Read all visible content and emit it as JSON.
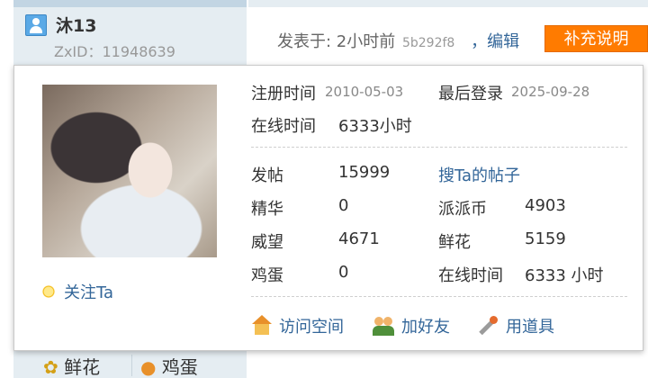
{
  "author": {
    "username": "沐13",
    "zxid": "ZxID：11948639"
  },
  "post": {
    "posted_prefix": "发表于: 2小时前",
    "hash": "5b292f8",
    "edit": "，编辑",
    "supplement_label": "补充说明"
  },
  "bottom": {
    "flower": "鲜花",
    "egg": "鸡蛋"
  },
  "card": {
    "follow_label": "关注Ta",
    "reg_label": "注册时间",
    "reg_date": "2010-05-03",
    "last_login_label": "最后登录",
    "last_login_date": "2025-09-28",
    "online_label": "在线时间",
    "online_value": "6333小时",
    "stats": {
      "posts_label": "发帖",
      "posts_value": "15999",
      "search_posts_link": "搜Ta的帖子",
      "digest_label": "精华",
      "digest_value": "0",
      "coin_label": "派派币",
      "coin_value": "4903",
      "prestige_label": "威望",
      "prestige_value": "4671",
      "flower_label": "鲜花",
      "flower_value": "5159",
      "egg_label": "鸡蛋",
      "egg_value": "0",
      "online_label": "在线时间",
      "online_value": "6333 小时"
    },
    "actions": {
      "visit_space": "访问空间",
      "add_friend": "加好友",
      "use_tool": "用道具"
    }
  }
}
